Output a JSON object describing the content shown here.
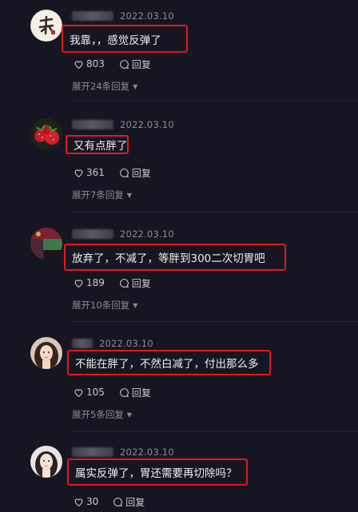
{
  "comments": [
    {
      "date": "2022.03.10",
      "text": "我靠，，感觉反弹了",
      "likes": "803",
      "reply_label": "回复",
      "expand_label": "展开24条回复",
      "avatar_icon": "avatar-calligraphy-icon"
    },
    {
      "date": "2022.03.10",
      "text": "又有点胖了",
      "likes": "361",
      "reply_label": "回复",
      "expand_label": "展开7条回复",
      "avatar_icon": "avatar-strawberry-icon"
    },
    {
      "date": "2022.03.10",
      "text": "放弃了，不减了，等胖到300二次切胃吧",
      "likes": "189",
      "reply_label": "回复",
      "expand_label": "展开10条回复",
      "avatar_icon": "avatar-photo-icon"
    },
    {
      "date": "2022.03.10",
      "text": "不能在胖了，不然白减了，付出那么多",
      "likes": "105",
      "reply_label": "回复",
      "expand_label": "展开5条回复",
      "avatar_icon": "avatar-girl-icon"
    },
    {
      "date": "2022.03.10",
      "text": "属实反弹了，胃还需要再切除吗？",
      "likes": "30",
      "reply_label": "回复",
      "avatar_icon": "avatar-girl-icon"
    }
  ],
  "colors": {
    "background": "#161622",
    "highlight_border": "#e3181b",
    "text": "#f0f0f2",
    "muted": "#8b8b94"
  }
}
